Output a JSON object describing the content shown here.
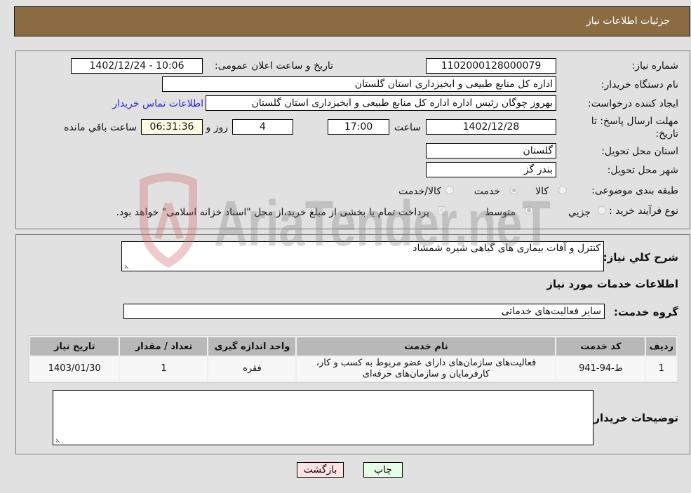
{
  "header": {
    "title": "جزئیات اطلاعات نیاز"
  },
  "details": {
    "need_number_label": "شماره نیاز:",
    "need_number": "1102000128000079",
    "announce_label": "تاریخ و ساعت اعلان عمومی:",
    "announce_value": "1402/12/24 - 10:06",
    "buyer_org_label": "نام دستگاه خریدار:",
    "buyer_org": "اداره کل منابع طبیعی و ابخیزداری استان گلستان",
    "creator_label": "ایجاد کننده درخواست:",
    "creator": "بهروز چوگان رئیس اداره اداره کل منابع طبیعی و ابخیزداری استان گلستان",
    "contact_link": "اطلاعات تماس خریدار",
    "deadline_label_line1": "مهلت ارسال پاسخ: تا",
    "deadline_label_line2": "تاریخ:",
    "deadline_date": "1402/12/28",
    "time_label": "ساعت",
    "deadline_time": "17:00",
    "days_value": "4",
    "days_label": "روز و",
    "remaining_time": "06:31:36",
    "remaining_label": "ساعت باقي مانده",
    "province_label": "استان محل تحویل:",
    "province": "گلستان",
    "city_label": "شهر محل تحویل:",
    "city": "بندر گز",
    "category_label": "طبقه بندی موضوعی:",
    "category_options": [
      {
        "label": "کالا",
        "checked": false
      },
      {
        "label": "خدمت",
        "checked": true
      },
      {
        "label": "کالا/خدمت",
        "checked": false
      }
    ],
    "process_label": "نوع فرآیند خرید :",
    "process_options": [
      {
        "label": "جزيي",
        "checked": false
      },
      {
        "label": "متوسط",
        "checked": true
      }
    ],
    "payment_note": "پرداخت تمام یا بخشی از مبلغ خرید،از محل \"اسناد خزانه اسلامی\" خواهد بود.",
    "payment_checked": true
  },
  "services": {
    "description_label": "شرح کلي نیاز:",
    "description": "کنترل و آفات بیماری های گیاهی شیره شمشاد",
    "section_title": "اطلاعات خدمات مورد نیاز",
    "group_label": "گروه خدمت:",
    "group_value": "سایر فعالیت‌های خدماتی",
    "table": {
      "columns": [
        "ردیف",
        "کد خدمت",
        "نام خدمت",
        "واحد اندازه گیری",
        "تعداد / مقدار",
        "تاریخ نیاز"
      ],
      "rows": [
        [
          "1",
          "ط-94-941",
          "فعالیت‌های سازمان‌های دارای عضو مربوط به کسب و کار، کارفرمایان و سازمان‌های حرفه‌ای",
          "فقره",
          "1",
          "1403/01/30"
        ]
      ]
    },
    "buyer_notes_label": "توضیحات خریدار:",
    "buyer_notes": ""
  },
  "buttons": {
    "print": "چاپ",
    "back": "بازگشت"
  },
  "watermark": {
    "text": "AriaTender.neT"
  },
  "colors": {
    "header": "#8b6c42",
    "print_bg": "#e8fde6",
    "back_bg": "#fde3e3",
    "link": "#2b2bd6"
  }
}
